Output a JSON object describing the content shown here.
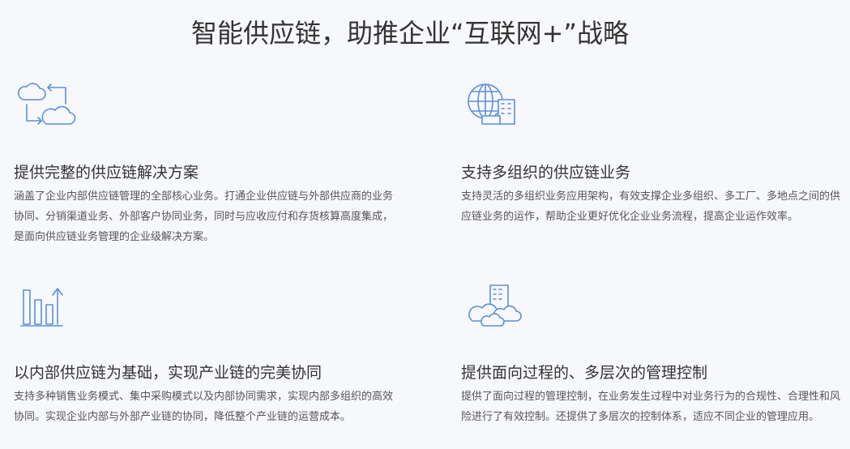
{
  "header": {
    "title": "智能供应链，助推企业“互联网+”战略"
  },
  "features": [
    {
      "icon": "cloud-sync-icon",
      "heading": "提供完整的供应链解决方案",
      "description": "涵盖了企业内部供应链管理的全部核心业务。打通企业供应链与外部供应商的业务协同、分销渠道业务、外部客户协同业务，同时与应收应付和存货核算高度集成，是面向供应链业务管理的企业级解决方案。"
    },
    {
      "icon": "globe-building-icon",
      "heading": "支持多组织的供应链业务",
      "description": "支持灵活的多组织业务应用架构，有效支撑企业多组织、多工厂、多地点之间的供应链业务的运作，帮助企业更好优化企业业务流程，提高企业运作效率。"
    },
    {
      "icon": "bar-chart-growth-icon",
      "heading": "以内部供应链为基础，实现产业链的完美协同",
      "description": "支持多种销售业务模式、集中采购模式以及内部协同需求，实现内部多组织的高效协同。实现企业内部与外部产业链的协同，降低整个产业链的运营成本。"
    },
    {
      "icon": "cloud-building-icon",
      "heading": "提供面向过程的、多层次的管理控制",
      "description": "提供了面向过程的管理控制，在业务发生过程中对业务行为的合规性、合理性和风险进行了有效控制。还提供了多层次的控制体系，适应不同企业的管理应用。"
    }
  ],
  "colors": {
    "icon_stroke": "#5b8fd9",
    "title_text": "#333333",
    "body_text": "#555555",
    "background": "#f7f8fc"
  }
}
